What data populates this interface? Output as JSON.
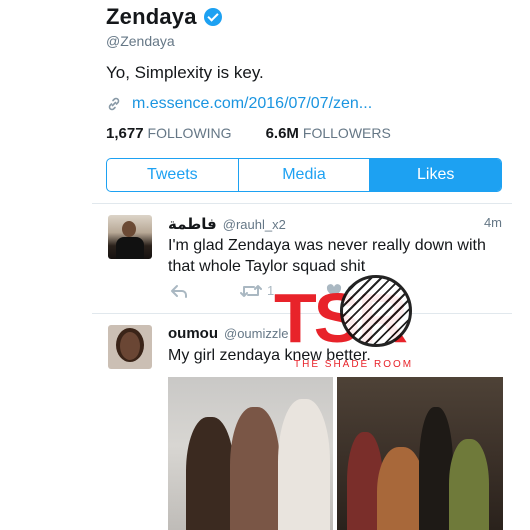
{
  "profile": {
    "name": "Zendaya",
    "handle": "@Zendaya",
    "bio": "Yo, Simplexity is key.",
    "link": "m.essence.com/2016/07/07/zen...",
    "following_count": "1,677",
    "following_label": "FOLLOWING",
    "followers_count": "6.6M",
    "followers_label": "FOLLOWERS"
  },
  "tabs": [
    {
      "label": "Tweets",
      "active": false
    },
    {
      "label": "Media",
      "active": false
    },
    {
      "label": "Likes",
      "active": true
    }
  ],
  "tweets": [
    {
      "author": "فاطمة",
      "handle": "@rauhl_x2",
      "time": "4m",
      "text": "I'm glad Zendaya was never really down with that whole Taylor squad shit",
      "retweets": "1",
      "likes": "3"
    },
    {
      "author": "oumou",
      "handle": "@oumizzle",
      "text": "My girl zendaya knew better."
    }
  ],
  "watermark": {
    "letters": "TSR",
    "caption": "THE SHADE ROOM"
  },
  "colors": {
    "accent": "#1da1f2",
    "link": "#1b95e0",
    "watermark_red": "#e8232a",
    "muted": "#657786"
  },
  "icons": [
    "verified-badge-icon",
    "link-icon",
    "reply-icon",
    "retweet-icon",
    "like-heart-icon"
  ]
}
